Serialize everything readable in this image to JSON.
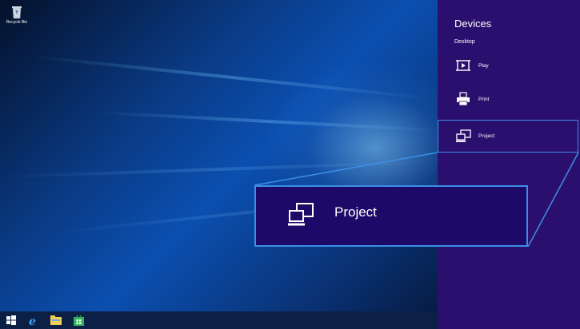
{
  "desktop": {
    "icons": [
      {
        "label": "Recycle Bin",
        "icon": "recycle-bin-icon"
      }
    ]
  },
  "taskbar": {
    "items": [
      "windows-start-icon",
      "internet-explorer-icon",
      "file-explorer-icon",
      "store-icon"
    ]
  },
  "charm": {
    "title": "Devices",
    "subtitle": "Desktop",
    "items": [
      {
        "label": "Play",
        "icon": "play-icon"
      },
      {
        "label": "Print",
        "icon": "printer-icon"
      },
      {
        "label": "Project",
        "icon": "project-icon"
      }
    ]
  },
  "callout": {
    "label": "Project",
    "icon": "project-icon"
  },
  "colors": {
    "charm_bg": "#2b0f6e",
    "callout_bg": "#1d0a68",
    "highlight": "#3b8fe6",
    "taskbar": "#0c1f45"
  }
}
